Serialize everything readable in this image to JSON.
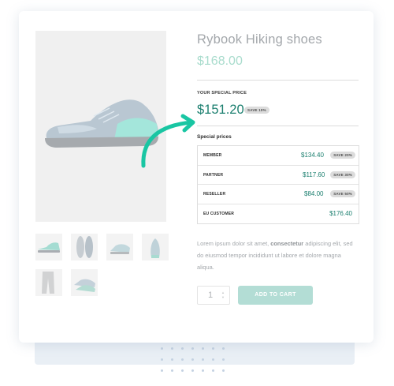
{
  "product": {
    "title": "Rybook Hiking shoes",
    "original_price": "$168.00"
  },
  "special": {
    "label": "YOUR SPECIAL PRICE",
    "price": "$151.20",
    "badge": "SAVE 10%"
  },
  "special_prices": {
    "title": "Special prices",
    "rows": [
      {
        "name": "MEMBER",
        "price": "$134.40",
        "badge": "SAVE 20%"
      },
      {
        "name": "PARTNER",
        "price": "$117.60",
        "badge": "SAVE 30%"
      },
      {
        "name": "RESELLER",
        "price": "$84.00",
        "badge": "SAVE 50%"
      },
      {
        "name": "EU CUSTOMER",
        "price": "$176.40",
        "badge": ""
      }
    ]
  },
  "description": {
    "before": "Lorem ipsum dolor sit amet, ",
    "bold": "consectetur",
    "after": " adipiscing elit, sed do eiusmod tempor incididunt ut labore et dolore magna aliqua."
  },
  "cart": {
    "quantity": "1",
    "add_label": "ADD TO CART"
  },
  "colors": {
    "accent": "#1b7f6f",
    "arrow": "#19c6a3",
    "button": "#b3ddd5"
  }
}
